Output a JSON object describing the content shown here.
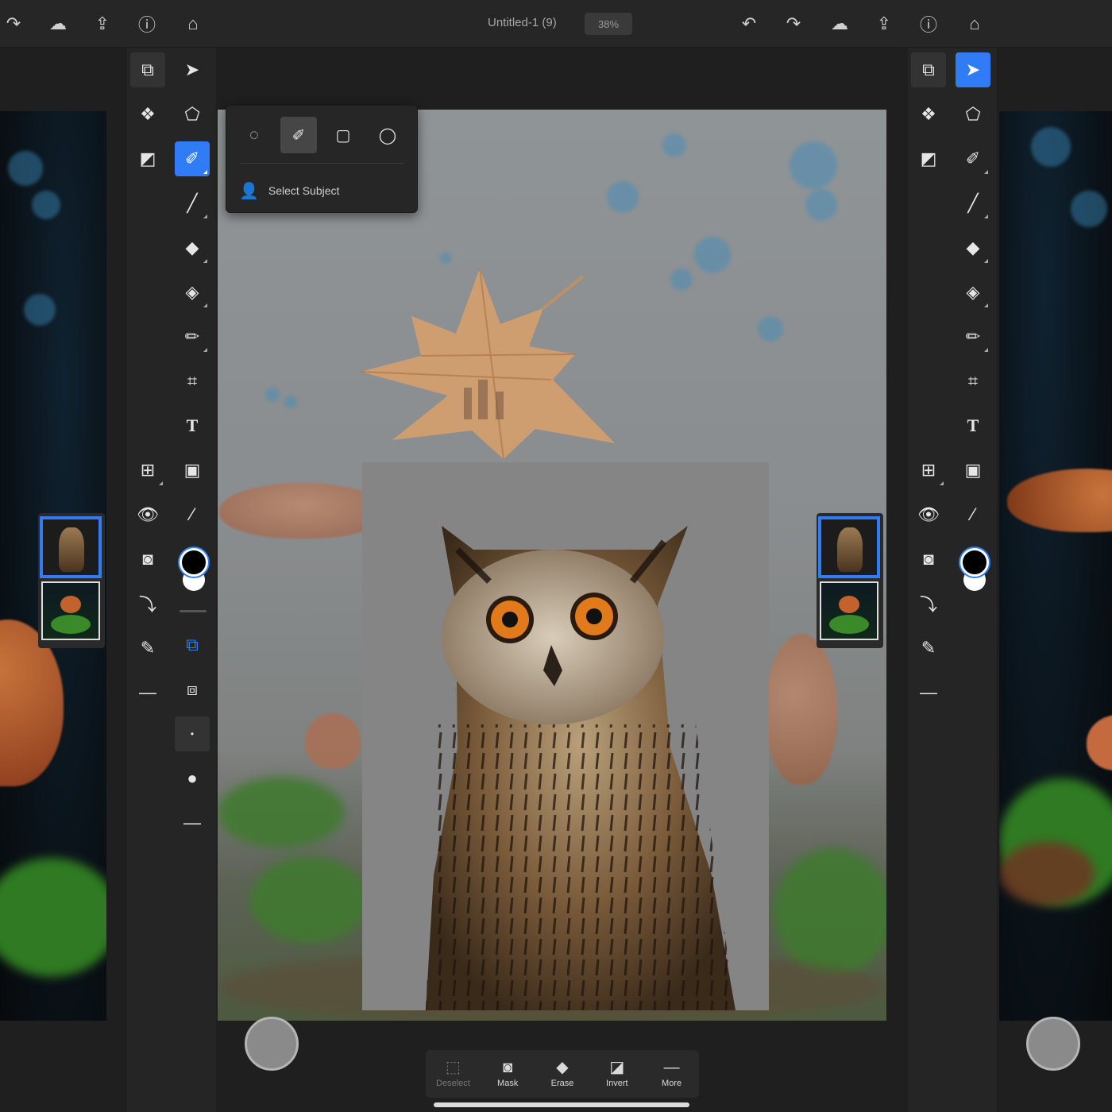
{
  "top_bar": {
    "document_title": "Untitled-1 (9)",
    "zoom": "38%",
    "left_icons": [
      "redo-icon",
      "cloud-icon",
      "share-icon",
      "help-icon",
      "home-icon"
    ],
    "right_icons": [
      "undo-icon",
      "redo-icon",
      "cloud-icon",
      "share-icon",
      "help-icon",
      "home-icon"
    ]
  },
  "left_toolbar": {
    "column_a": [
      "layers-icon",
      "layer-properties-icon",
      "adjustment-layer-icon",
      "add-layer-icon",
      "visibility-icon",
      "mask-icon",
      "clipping-icon",
      "fx-icon",
      "more-icon"
    ],
    "column_b": [
      "move-icon",
      "transform-icon",
      "selection-brush-icon",
      "brush-icon",
      "eraser-icon",
      "fill-icon",
      "healing-icon",
      "crop-icon",
      "type-icon",
      "place-image-icon",
      "eyedropper-icon"
    ],
    "active_tool": "selection-brush-icon",
    "extras": [
      "subtract-selection-icon",
      "intersect-selection-icon",
      "brush-size-icon",
      "brush-hardness-icon",
      "more-options-icon"
    ]
  },
  "selection_popover": {
    "tools": [
      "lasso-icon",
      "selection-brush-icon",
      "rectangle-icon",
      "ellipse-icon"
    ],
    "selected_tool": "selection-brush-icon",
    "select_subject_label": "Select Subject"
  },
  "right_toolbar": {
    "active_tool": "move-icon"
  },
  "bottom_bar": {
    "items": [
      {
        "label": "Deselect",
        "icon": "deselect-icon",
        "enabled": false
      },
      {
        "label": "Mask",
        "icon": "mask-icon",
        "enabled": true
      },
      {
        "label": "Erase",
        "icon": "erase-icon",
        "enabled": true
      },
      {
        "label": "Invert",
        "icon": "invert-icon",
        "enabled": true
      },
      {
        "label": "More",
        "icon": "more-icon",
        "enabled": true
      }
    ]
  },
  "layers": [
    {
      "name": "owl",
      "selected": true
    },
    {
      "name": "mushroom-scene",
      "selected": false
    }
  ],
  "colors": {
    "accent": "#2f7cf6",
    "toolbar": "#252525",
    "canvas_bg": "#1f1f1f",
    "foreground": "#000000",
    "background": "#ffffff"
  }
}
